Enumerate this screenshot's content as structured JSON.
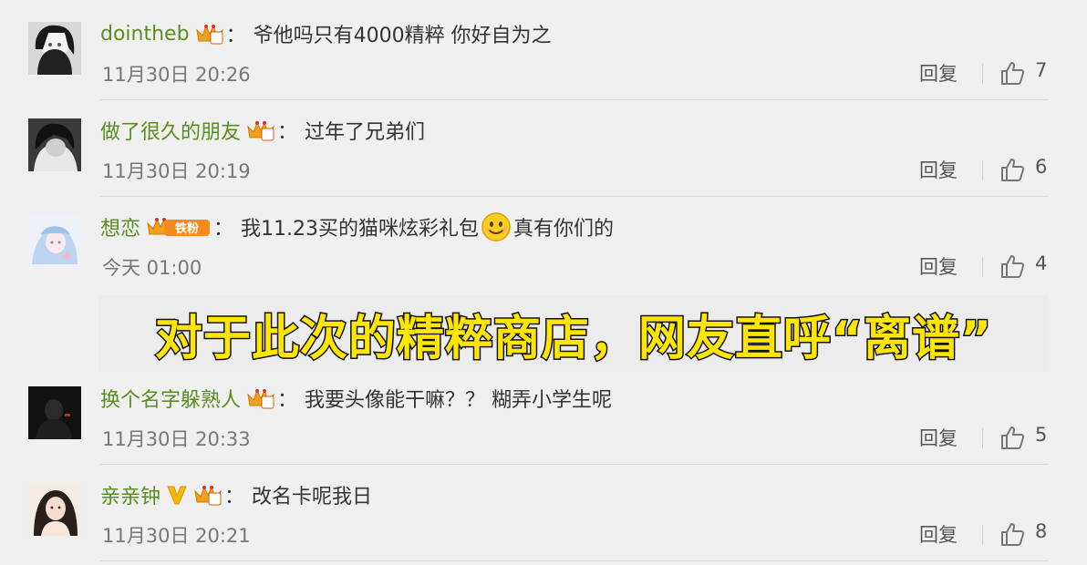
{
  "comments": [
    {
      "username": "dointheb",
      "crown_level": "4",
      "text": "爷他吗只有4000精粹 你好自为之",
      "time": "11月30日 20:26",
      "reply": "回复",
      "likes": "7"
    },
    {
      "username": "做了很久的朋友",
      "crown_level": "4",
      "text": "过年了兄弟们",
      "time": "11月30日 20:19",
      "reply": "回复",
      "likes": "6"
    },
    {
      "username": "想恋",
      "crown_level": "5",
      "crown_tag": "铁粉",
      "text_before": "我11.23买的猫咪炫彩礼包",
      "text_after": "真有你们的",
      "time": "今天 01:00",
      "reply": "回复",
      "likes": "4"
    },
    {
      "username": "换个名字躲熟人",
      "crown_level": "6",
      "text": "我要头像能干嘛？？ 糊弄小学生呢",
      "time": "11月30日 20:33",
      "reply": "回复",
      "likes": "5"
    },
    {
      "username": "亲亲钟",
      "crown_level": "3",
      "text": "改名卡呢我日",
      "time": "11月30日 20:21",
      "reply": "回复",
      "likes": "8"
    }
  ],
  "banner": {
    "text": "对于此次的精粹商店，网友直呼“离谱”"
  },
  "colors": {
    "username": "#5a8e1f",
    "banner_fill": "#ffe600",
    "crown": "#f0a020",
    "verified": "#f5b700"
  }
}
